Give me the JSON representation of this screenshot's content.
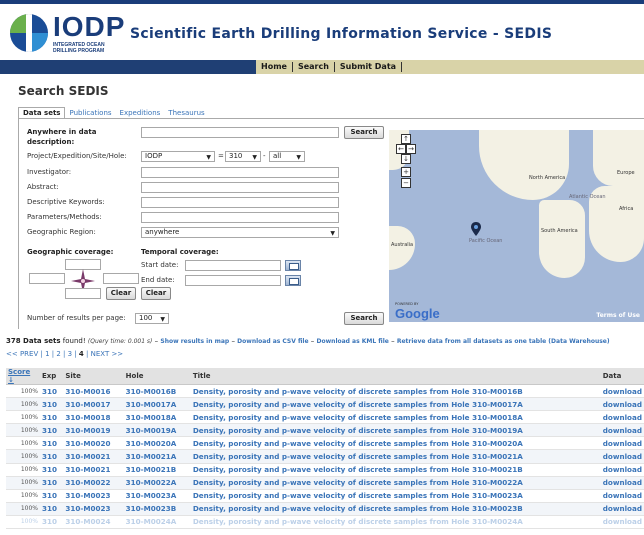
{
  "header": {
    "logo_text": "IODP",
    "logo_sub": "INTEGRATED OCEAN DRILLING PROGRAM",
    "site_title": "Scientific Earth Drilling Information Service - SEDIS"
  },
  "nav": [
    "Home",
    "Search",
    "Submit Data"
  ],
  "page": {
    "heading": "Search SEDIS"
  },
  "tabs": [
    "Data sets",
    "Publications",
    "Expeditions",
    "Thesaurus"
  ],
  "form": {
    "anywhere_label": "Anywhere in data description:",
    "search_button": "Search",
    "project_label": "Project/Expedition/Site/Hole:",
    "project_value": "IODP",
    "equals": "=",
    "exp_value": "310",
    "dash": "-",
    "hole_value": "all",
    "investigator_label": "Investigator:",
    "abstract_label": "Abstract:",
    "keywords_label": "Descriptive Keywords:",
    "parameters_label": "Parameters/Methods:",
    "region_label": "Geographic Region:",
    "region_value": "anywhere",
    "geo_label": "Geographic coverage:",
    "temporal_label": "Temporal coverage:",
    "start_label": "Start date:",
    "end_label": "End date:",
    "clear_button": "Clear",
    "results_label": "Number of results per page:",
    "results_value": "100"
  },
  "map": {
    "labels": {
      "north_america": "North America",
      "atlantic": "Atlantic Ocean",
      "europe": "Europe",
      "africa": "Africa",
      "south_america": "South America",
      "australia": "Australia",
      "pacific": "Pacific Ocean"
    },
    "powered": "POWERED BY",
    "google": "Google",
    "terms": "Terms of Use"
  },
  "results": {
    "count": "378 Data sets",
    "found": "found!",
    "query_time": "(Query time: 0.001 s)",
    "sep": "–",
    "link_map": "Show results in map",
    "link_csv": "Download as CSV file",
    "link_kml": "Download as KML file",
    "link_retrieve": "Retrieve data from all datasets as one table (Data Warehouse)"
  },
  "pager": {
    "prev": "<< PREV",
    "pages": [
      "1",
      "2",
      "3"
    ],
    "current": "4",
    "next": "NEXT >>"
  },
  "table": {
    "headers": [
      "Score ↓",
      "Exp",
      "Site",
      "Hole",
      "Title",
      "Data"
    ],
    "rows": [
      {
        "score": "100%",
        "exp": "310",
        "site": "310-M0016",
        "hole": "310-M0016B",
        "title": "Density, porosity and p-wave velocity of discrete samples from Hole 310-M0016B",
        "data": "download"
      },
      {
        "score": "100%",
        "exp": "310",
        "site": "310-M0017",
        "hole": "310-M0017A",
        "title": "Density, porosity and p-wave velocity of discrete samples from Hole 310-M0017A",
        "data": "download"
      },
      {
        "score": "100%",
        "exp": "310",
        "site": "310-M0018",
        "hole": "310-M0018A",
        "title": "Density, porosity and p-wave velocity of discrete samples from Hole 310-M0018A",
        "data": "download"
      },
      {
        "score": "100%",
        "exp": "310",
        "site": "310-M0019",
        "hole": "310-M0019A",
        "title": "Density, porosity and p-wave velocity of discrete samples from Hole 310-M0019A",
        "data": "download"
      },
      {
        "score": "100%",
        "exp": "310",
        "site": "310-M0020",
        "hole": "310-M0020A",
        "title": "Density, porosity and p-wave velocity of discrete samples from Hole 310-M0020A",
        "data": "download"
      },
      {
        "score": "100%",
        "exp": "310",
        "site": "310-M0021",
        "hole": "310-M0021A",
        "title": "Density, porosity and p-wave velocity of discrete samples from Hole 310-M0021A",
        "data": "download"
      },
      {
        "score": "100%",
        "exp": "310",
        "site": "310-M0021",
        "hole": "310-M0021B",
        "title": "Density, porosity and p-wave velocity of discrete samples from Hole 310-M0021B",
        "data": "download"
      },
      {
        "score": "100%",
        "exp": "310",
        "site": "310-M0022",
        "hole": "310-M0022A",
        "title": "Density, porosity and p-wave velocity of discrete samples from Hole 310-M0022A",
        "data": "download"
      },
      {
        "score": "100%",
        "exp": "310",
        "site": "310-M0023",
        "hole": "310-M0023A",
        "title": "Density, porosity and p-wave velocity of discrete samples from Hole 310-M0023A",
        "data": "download"
      },
      {
        "score": "100%",
        "exp": "310",
        "site": "310-M0023",
        "hole": "310-M0023B",
        "title": "Density, porosity and p-wave velocity of discrete samples from Hole 310-M0023B",
        "data": "download"
      },
      {
        "score": "100%",
        "exp": "310",
        "site": "310-M0024",
        "hole": "310-M0024A",
        "title": "Density, porosity and p-wave velocity of discrete samples from Hole 310-M0024A",
        "data": "download"
      }
    ]
  }
}
